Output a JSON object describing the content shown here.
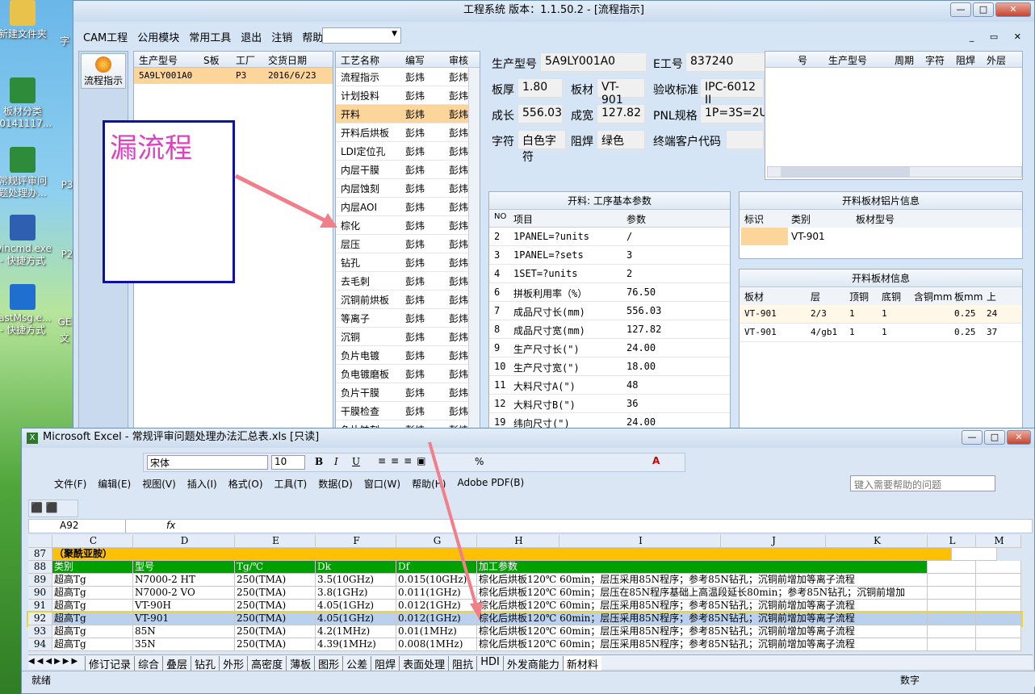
{
  "desktop_icons": [
    {
      "label": "新建文件夹",
      "icon": "folder-icon"
    },
    {
      "label": "板材分类\n20141117...",
      "icon": "excel-file-icon"
    },
    {
      "label": "常规评审问\n题处理办...",
      "icon": "excel-file-icon"
    },
    {
      "label": "wincmd.exe\n- 快捷方式",
      "icon": "save-disk-icon"
    },
    {
      "label": "FastMsg.e...\n- 快捷方式",
      "icon": "fastmsg-icon"
    }
  ],
  "desktop_partial": [
    "字",
    "P3",
    "P2",
    "GE",
    "文"
  ],
  "main": {
    "title": "工程系统   版本：1.1.50.2 - [流程指示]",
    "menu": [
      "CAM工程",
      "公用模块",
      "常用工具",
      "退出",
      "注销",
      "帮助"
    ],
    "side_button": "流程指示",
    "model_table": {
      "headers": [
        "生产型号",
        "S板",
        "工厂",
        "交货日期"
      ],
      "row": [
        "5A9LY001A0",
        "",
        "P3",
        "2016/6/23"
      ]
    },
    "process_headers": [
      "工艺名称",
      "编写",
      "审核"
    ],
    "processes": [
      [
        "流程指示",
        "彭炜",
        "彭炜"
      ],
      [
        "计划投料",
        "彭炜",
        "彭炜"
      ],
      [
        "开料",
        "彭炜",
        "彭炜"
      ],
      [
        "开料后烘板",
        "彭炜",
        "彭炜"
      ],
      [
        "LDI定位孔",
        "彭炜",
        "彭炜"
      ],
      [
        "内层干膜",
        "彭炜",
        "彭炜"
      ],
      [
        "内层蚀刻",
        "彭炜",
        "彭炜"
      ],
      [
        "内层AOI",
        "彭炜",
        "彭炜"
      ],
      [
        "棕化",
        "彭炜",
        "彭炜"
      ],
      [
        "层压",
        "彭炜",
        "彭炜"
      ],
      [
        "钻孔",
        "彭炜",
        "彭炜"
      ],
      [
        "去毛刺",
        "彭炜",
        "彭炜"
      ],
      [
        "沉铜前烘板",
        "彭炜",
        "彭炜"
      ],
      [
        "等离子",
        "彭炜",
        "彭炜"
      ],
      [
        "沉铜",
        "彭炜",
        "彭炜"
      ],
      [
        "负片电镀",
        "彭炜",
        "彭炜"
      ],
      [
        "负电镀磨板",
        "彭炜",
        "彭炜"
      ],
      [
        "负片干膜",
        "彭炜",
        "彭炜"
      ],
      [
        "干膜检查",
        "彭炜",
        "彭炜"
      ],
      [
        "负片蚀刻",
        "彭炜",
        "彭炜"
      ]
    ],
    "annotation": "漏流程",
    "info": {
      "model_label": "生产型号",
      "model": "5A9LY001A0",
      "eno_label": "E工号",
      "eno": "837240",
      "thick_label": "板厚",
      "thick": "1.80",
      "mat_label": "板材",
      "mat": "VT-901",
      "std_label": "验收标准",
      "std": "IPC-6012 II",
      "len_label": "成长",
      "len": "556.03",
      "wid_label": "成宽",
      "wid": "127.82",
      "pnl_label": "PNL规格",
      "pnl": "1P=3S=2U",
      "char_label": "字符",
      "char": "白色字符",
      "mask_label": "阻焊",
      "mask": "绿色",
      "cust_label": "终端客户代码"
    },
    "right_grid_headers": [
      "号",
      "生产型号",
      "周期",
      "字符",
      "阻焊",
      "外层"
    ],
    "params": {
      "title": "开料: 工序基本参数",
      "headers": [
        "NO",
        "项目",
        "参数"
      ],
      "rows": [
        [
          "2",
          "1PANEL=?units",
          "/"
        ],
        [
          "3",
          "1PANEL=?sets",
          "3"
        ],
        [
          "4",
          "1SET=?units",
          "2"
        ],
        [
          "6",
          "拼板利用率（%）",
          "76.50"
        ],
        [
          "7",
          "成品尺寸长(mm)",
          "556.03"
        ],
        [
          "8",
          "成品尺寸宽(mm)",
          "127.82"
        ],
        [
          "9",
          "生产尺寸长(\")",
          "24.00"
        ],
        [
          "10",
          "生产尺寸宽(\")",
          "18.00"
        ],
        [
          "11",
          "大料尺寸A(\")",
          "48"
        ],
        [
          "12",
          "大料尺寸B(\")",
          "36"
        ],
        [
          "19",
          "纬向尺寸(\")",
          "24.00"
        ]
      ]
    },
    "alu": {
      "title": "开料板材铝片信息",
      "headers": [
        "标识",
        "类别",
        "板材型号"
      ],
      "row": [
        "",
        "VT-901",
        ""
      ]
    },
    "matinfo": {
      "title": "开料板材信息",
      "headers": [
        "板材",
        "层",
        "顶铜",
        "底铜",
        "含铜mm",
        "板mm",
        "上"
      ],
      "rows": [
        [
          "VT-901",
          "2/3",
          "1",
          "1",
          "",
          "0.25",
          "24"
        ],
        [
          "VT-901",
          "4/gb1",
          "1",
          "1",
          "",
          "0.25",
          "37"
        ]
      ]
    }
  },
  "excel": {
    "title": "Microsoft Excel - 常规评审问题处理办法汇总表.xls  [只读]",
    "font": "宋体",
    "size": "10",
    "menu": [
      "文件(F)",
      "编辑(E)",
      "视图(V)",
      "插入(I)",
      "格式(O)",
      "工具(T)",
      "数据(D)",
      "窗口(W)",
      "帮助(H)",
      "Adobe PDF(B)"
    ],
    "help_placeholder": "键入需要帮助的问题",
    "namebox": "A92",
    "fx": "fx",
    "cols": [
      "C",
      "D",
      "E",
      "F",
      "G",
      "H",
      "I",
      "J",
      "K",
      "L",
      "M"
    ],
    "rows": [
      {
        "n": "87",
        "cells": [
          "（聚酰亚胺）"
        ],
        "style": "gold"
      },
      {
        "n": "88",
        "cells": [
          "类别",
          "型号",
          "Tg/℃",
          "Dk",
          "Df",
          "加工参数"
        ],
        "style": "green"
      },
      {
        "n": "89",
        "cells": [
          "超高Tg",
          "N7000-2 HT",
          "250(TMA)",
          "3.5(10GHz)",
          "0.015(10GHz)",
          "棕化后烘板120℃ 60min；层压采用85N程序；参考85N钻孔；沉铜前增加等离子流程"
        ]
      },
      {
        "n": "90",
        "cells": [
          "超高Tg",
          "N7000-2 VO",
          "250(TMA)",
          "3.8(1GHz)",
          "0.011(1GHz)",
          "棕化后烘板120℃ 60min；层压在85N程序基础上高温段延长80min；参考85N钻孔；沉铜前增加"
        ]
      },
      {
        "n": "91",
        "cells": [
          "超高Tg",
          "VT-90H",
          "250(TMA)",
          "4.05(1GHz)",
          "0.012(1GHz)",
          "棕化后烘板120℃ 60min；层压采用85N程序；参考85N钻孔；沉铜前增加等离子流程"
        ]
      },
      {
        "n": "92",
        "cells": [
          "超高Tg",
          "VT-901",
          "250(TMA)",
          "4.05(1GHz)",
          "0.012(1GHz)",
          "棕化后烘板120℃ 60min；层压采用85N程序；参考85N钻孔；沉铜前增加等离子流程"
        ],
        "style": "sel"
      },
      {
        "n": "93",
        "cells": [
          "超高Tg",
          "85N",
          "250(TMA)",
          "4.2(1MHz)",
          "0.01(1MHz)",
          "棕化后烘板120℃ 60min；层压采用85N程序；参考85N钻孔；沉铜前增加等离子流程"
        ]
      },
      {
        "n": "94",
        "cells": [
          "超高Tg",
          "35N",
          "250(TMA)",
          "4.39(1MHz)",
          "0.008(1MHz)",
          "棕化后烘板120℃ 60min；层压采用85N程序；参考85N钻孔；沉铜前增加等离子流程"
        ]
      }
    ],
    "sheets": [
      "修订记录",
      "综合",
      "叠层",
      "钻孔",
      "外形",
      "高密度",
      "薄板",
      "图形",
      "公差",
      "阻焊",
      "表面处理",
      "阻抗",
      "HDI",
      "外发商能力",
      "新材料"
    ],
    "status_left": "就绪",
    "status_right": "数字"
  },
  "colors": {
    "highlight": "#fcd59b",
    "selected_row": "#b9d1ee",
    "gold": "#ffc000",
    "green": "#00a000",
    "annotation": "#e040c0",
    "arrow": "#f07f8a"
  }
}
